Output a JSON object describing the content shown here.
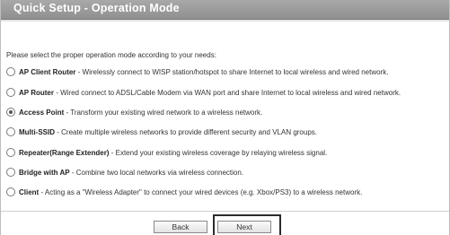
{
  "header": {
    "title": "Quick Setup - Operation Mode"
  },
  "intro_text": "Please select the proper operation mode according to your needs:",
  "options": [
    {
      "name": "AP Client Router",
      "desc": "- Wirelessly connect to WISP station/hotspot to share Internet to local wireless and wired network.",
      "checked": false
    },
    {
      "name": "AP Router",
      "desc": "- Wired connect to ADSL/Cable Modem via WAN port and share Internet to local wireless and wired network.",
      "checked": false
    },
    {
      "name": "Access Point",
      "desc": "- Transform your existing wired network to a wireless network.",
      "checked": true
    },
    {
      "name": "Multi-SSID",
      "desc": "- Create multiple wireless networks to provide different security and VLAN groups.",
      "checked": false
    },
    {
      "name": "Repeater(Range Extender)",
      "desc": "- Extend your existing wireless coverage by relaying wireless signal.",
      "checked": false
    },
    {
      "name": "Bridge with AP",
      "desc": "- Combine two local networks via wireless connection.",
      "checked": false
    },
    {
      "name": "Client",
      "desc": "- Acting as a \"Wireless Adapter\" to connect your wired devices (e.g. Xbox/PS3) to a wireless network.",
      "checked": false
    }
  ],
  "buttons": {
    "back_label": "Back",
    "next_label": "Next"
  },
  "colors": {
    "title_bar": "#9c9c9c",
    "title_text": "#ffffff"
  }
}
